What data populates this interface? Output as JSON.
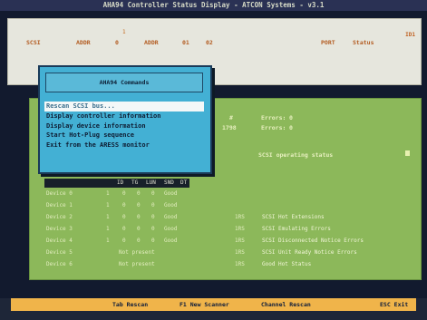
{
  "title": "AHA94 Controller Status Display - ATCON Systems - v3.1",
  "info": {
    "marker": "1",
    "fields": [
      "SCSI",
      "ADDR",
      "0",
      "ADDR",
      "01",
      "02"
    ],
    "right_fields": [
      "PORT",
      "Status"
    ],
    "corner_tag": "ID1"
  },
  "commands": {
    "title": "AHA94 Commands",
    "items": [
      "Rescan SCSI bus...",
      "Display controller information",
      "Display device information",
      "Start Hot-Plug sequence",
      "Exit from the ARESS monitor"
    ],
    "selected_index": 0
  },
  "status": {
    "line1_right": [
      "#",
      "Errors:",
      "0"
    ],
    "line2_right": [
      "1798",
      "Errors:",
      "0"
    ],
    "line3": "SCSI operating status",
    "marker_color": "#e8f0b0"
  },
  "table": {
    "headers": [
      "ID",
      "TG",
      "LUN",
      "SND",
      "DT"
    ],
    "rows": [
      {
        "label": "Device 0",
        "cols": [
          "1",
          "0",
          "0",
          "0",
          "Good"
        ],
        "note": ""
      },
      {
        "label": "Device 1",
        "cols": [
          "1",
          "0",
          "0",
          "0",
          "Good"
        ],
        "note": ""
      },
      {
        "label": "Device 2",
        "cols": [
          "1",
          "0",
          "0",
          "0",
          "Good"
        ],
        "note": "SCSI Hot Extensions"
      },
      {
        "label": "Device 3",
        "cols": [
          "1",
          "0",
          "0",
          "0",
          "Good"
        ],
        "note": "SCSI Emulating Errors"
      },
      {
        "label": "Device 4",
        "cols": [
          "1",
          "0",
          "0",
          "0",
          "Good"
        ],
        "note": "SCSI Disconnected Notice Errors"
      },
      {
        "label": "Device 5",
        "cols": [
          "Not present",
          "",
          "",
          "",
          ""
        ],
        "note": "SCSI Unit Ready Notice Errors"
      },
      {
        "label": "Device 6",
        "cols": [
          "Not present",
          "",
          "",
          "",
          ""
        ],
        "note": "Good Hot Status"
      }
    ],
    "row_codes": [
      "",
      "",
      "1RS",
      "1RS",
      "1RS",
      "1RS",
      "1RS"
    ]
  },
  "footer": {
    "keys": [
      "Tab Rescan",
      "F1 New Scanner",
      "Channel Rescan",
      "ESC Exit"
    ]
  }
}
